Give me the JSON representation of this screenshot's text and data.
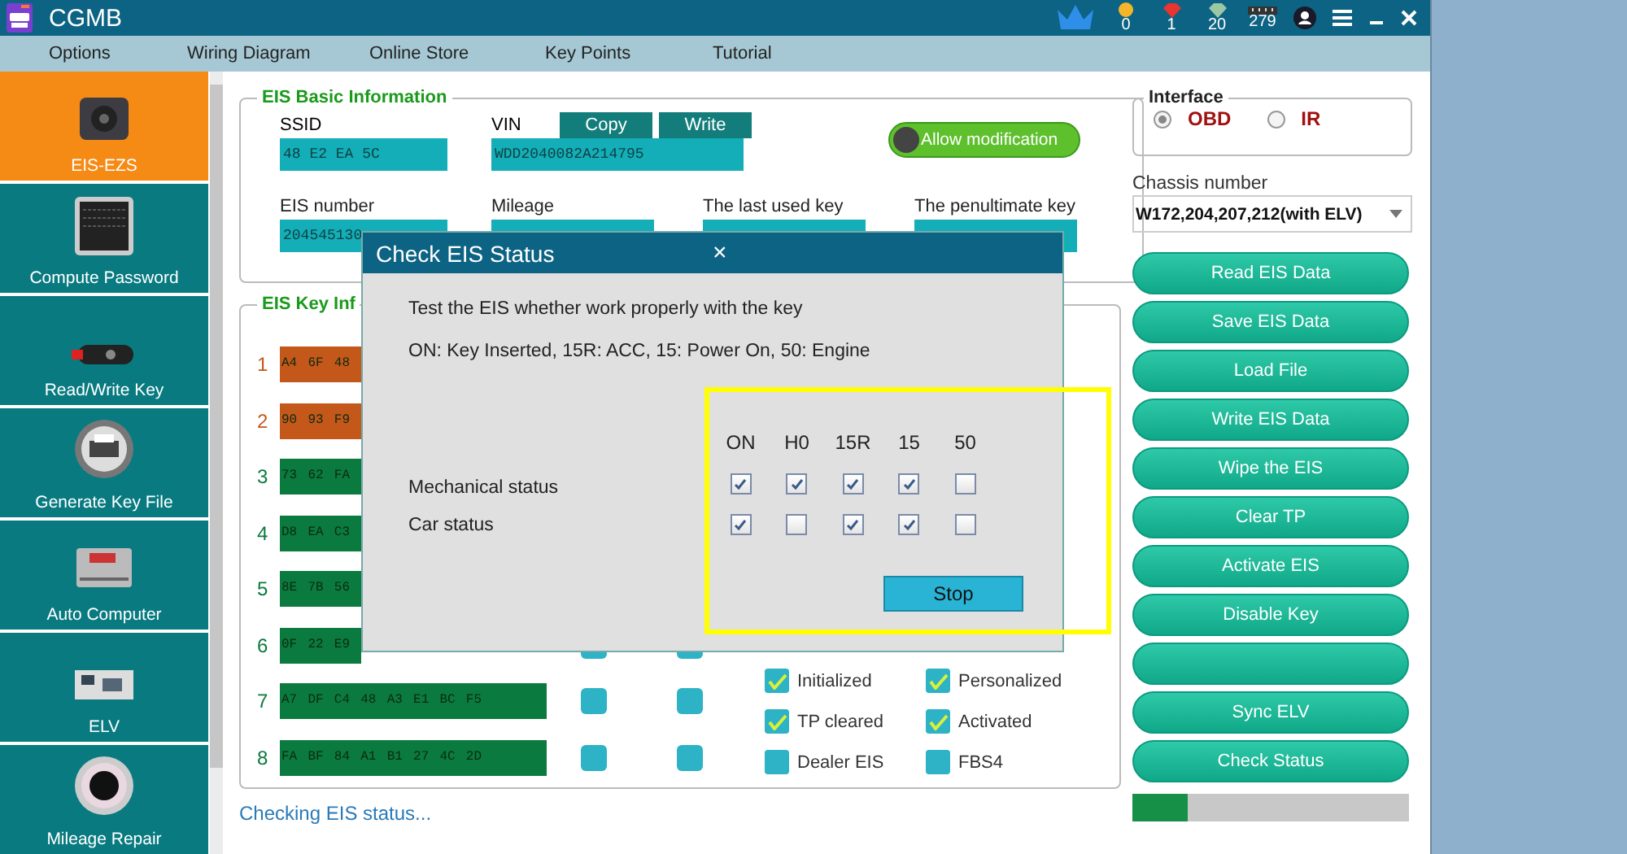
{
  "window": {
    "title": "CGMB"
  },
  "title_bar": {
    "counters": [
      {
        "kind": "coin",
        "value": "0"
      },
      {
        "kind": "ruby",
        "value": "1"
      },
      {
        "kind": "diamond",
        "value": "20"
      },
      {
        "kind": "chip",
        "value": "279"
      }
    ]
  },
  "menu": [
    "Options",
    "Wiring Diagram",
    "Online Store",
    "Key Points",
    "Tutorial"
  ],
  "sidebar": {
    "items": [
      {
        "label": "EIS-EZS",
        "kind": "ignition",
        "selected": true
      },
      {
        "label": "Compute Password",
        "kind": "keypad",
        "selected": false
      },
      {
        "label": "Read/Write Key",
        "kind": "key",
        "selected": false
      },
      {
        "label": "Generate Key File",
        "kind": "printer",
        "selected": false
      },
      {
        "label": "Auto Computer",
        "kind": "ecu",
        "selected": false
      },
      {
        "label": "ELV",
        "kind": "board",
        "selected": false
      },
      {
        "label": "Mileage Repair",
        "kind": "gauge",
        "selected": false
      }
    ]
  },
  "basic_info": {
    "title": "EIS Basic Information",
    "ssid": {
      "label": "SSID",
      "value": "48  E2  EA  5C"
    },
    "vin": {
      "label": "VIN",
      "value": "WDD2040082A214795"
    },
    "copy": "Copy",
    "write": "Write",
    "allow_modification": {
      "label": "Allow modification",
      "on": false
    },
    "fields": [
      {
        "label": "EIS number",
        "value": "204545130"
      },
      {
        "label": "Mileage"
      },
      {
        "label": "The last used key"
      },
      {
        "label": "The penultimate key"
      }
    ]
  },
  "key_info": {
    "title": "EIS Key Inf",
    "rows": [
      {
        "number": "1",
        "key": "A4  6F  48",
        "color": "#c4581a"
      },
      {
        "number": "2",
        "key": "90  93  F9",
        "color": "#c4581a"
      },
      {
        "number": "3",
        "key": "73  62  FA",
        "color": "#0b7a3e"
      },
      {
        "number": "4",
        "key": "D8  EA  C3",
        "color": "#0b7a3e"
      },
      {
        "number": "5",
        "key": "8E  7B  56",
        "color": "#0b7a3e"
      },
      {
        "number": "6",
        "key": "0F  22  E9",
        "color": "#0b7a3e"
      },
      {
        "number": "7",
        "key": "A7  DF  C4  48  A3  E1  BC  F5",
        "color": "#0b7a3e"
      },
      {
        "number": "8",
        "key": "FA  BF  84  A1  B1  27  4C  2D",
        "color": "#0b7a3e"
      }
    ],
    "flags": [
      {
        "label": "Initialized",
        "checked": true
      },
      {
        "label": "Personalized",
        "checked": true
      },
      {
        "label": "TP cleared",
        "checked": true
      },
      {
        "label": "Activated",
        "checked": true
      },
      {
        "label": "Dealer EIS",
        "checked": false
      },
      {
        "label": "FBS4",
        "checked": false
      }
    ]
  },
  "status_text": "Checking  EIS  status...",
  "interface": {
    "title": "Interface",
    "options": [
      {
        "label": "OBD",
        "selected": true
      },
      {
        "label": "IR",
        "selected": false
      }
    ]
  },
  "chassis": {
    "label": "Chassis number",
    "value": "W172,204,207,212(with  ELV)"
  },
  "actions": [
    {
      "kind": "labeled",
      "label": "Read EIS Data"
    },
    {
      "kind": "labeled",
      "label": "Save EIS Data"
    },
    {
      "kind": "labeled",
      "label": "Load File"
    },
    {
      "kind": "labeled",
      "label": "Write EIS Data"
    },
    {
      "kind": "labeled",
      "label": "Wipe the EIS"
    },
    {
      "kind": "labeled",
      "label": "Clear TP"
    },
    {
      "kind": "labeled",
      "label": "Activate EIS"
    },
    {
      "kind": "labeled",
      "label": "Disable Key"
    },
    {
      "kind": "blank"
    },
    {
      "kind": "labeled",
      "label": "Sync ELV"
    },
    {
      "kind": "labeled",
      "label": "Check Status"
    }
  ],
  "progress": {
    "level": 0.2
  },
  "dialog": {
    "title": "Check EIS Status",
    "close": "×",
    "lines": [
      "Test the EIS whether work properly with the key",
      "ON: Key Inserted, 15R: ACC, 15: Power On, 50: Engine"
    ],
    "columns": [
      "ON",
      "H0",
      "15R",
      "15",
      "50"
    ],
    "rows": [
      {
        "label": "Mechanical status",
        "checks": [
          true,
          true,
          true,
          true,
          false
        ]
      },
      {
        "label": "Car status",
        "checks": [
          true,
          false,
          true,
          true,
          false
        ]
      }
    ],
    "stop": "Stop"
  }
}
